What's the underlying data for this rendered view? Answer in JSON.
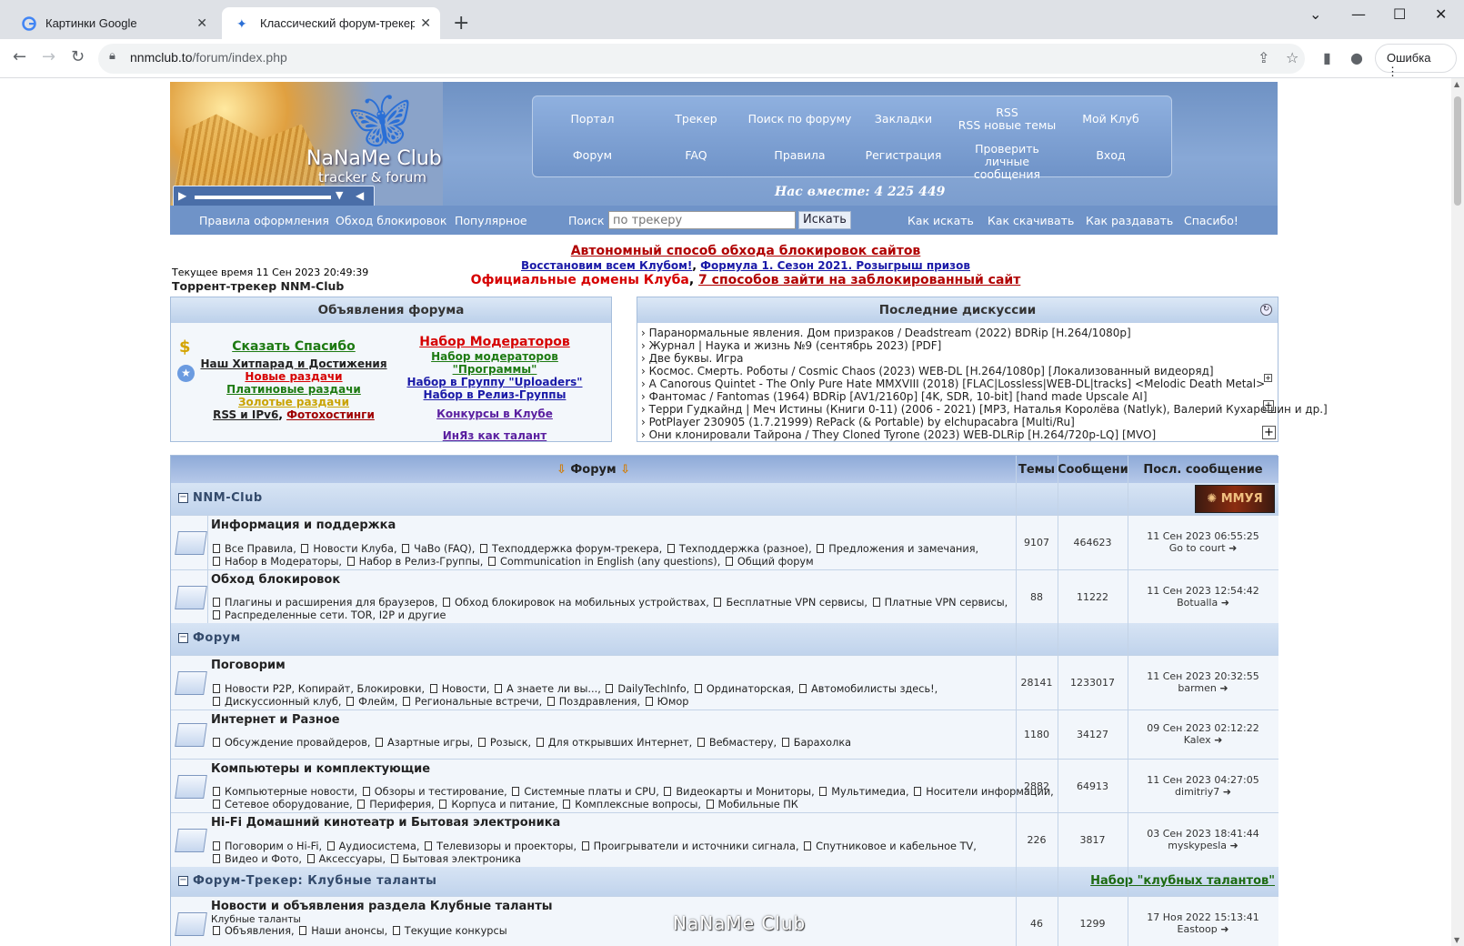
{
  "browser": {
    "tabs": [
      {
        "title": "Картинки Google",
        "close": "✕"
      },
      {
        "title": "Классический форум-трекер :: N",
        "close": "✕"
      }
    ],
    "new_tab": "+",
    "url_host": "nnmclub.to",
    "url_path": "/forum/index.php",
    "error_button": "Ошибка"
  },
  "header": {
    "logo_title": "NaNaMe Club",
    "logo_subtitle": "tracker & forum",
    "menu_top": [
      "Портал",
      "Трекер",
      "Поиск по форуму",
      "Закладки",
      "RSS\nRSS новые темы",
      "Мой Клуб"
    ],
    "menu_bottom": [
      "Форум",
      "FAQ",
      "Правила",
      "Регистрация",
      "Проверить личные сообщения",
      "Вход"
    ],
    "together": "Нас вместе: 4 225 449"
  },
  "subnav": {
    "left_links": [
      "Правила оформления",
      "Обход блокировок",
      "Популярное"
    ],
    "search_label": "Поиск :",
    "search_placeholder": "по трекеру",
    "search_button": "Искать",
    "right_links": [
      "Как искать",
      "Как скачивать",
      "Как раздавать",
      "Спасибо!"
    ]
  },
  "info": {
    "current_time": "Текущее время 11 Сен 2023 20:49:39",
    "site_name": "Торрент-трекер NNM-Club",
    "headline": "Автономный способ обхода блокировок сайтов",
    "line2_a": "Восстановим всем Клубом!",
    "line2_b": "Формула 1. Сезон 2021. Розыгрыш призов",
    "line3_a": "Официальные домены Клуба",
    "line3_b": "7 способов зайти на заблокированный сайт"
  },
  "announcements": {
    "title": "Объявления форума",
    "left": [
      "Сказать Спасибо",
      "Наш Хитпарад и Достижения",
      "Новые раздачи",
      "Платиновые раздачи",
      "Золотые раздачи",
      "RSS и IPv6",
      "Фотохостинги"
    ],
    "right": [
      "Набор Модераторов",
      "Набор модераторов \"Программы\"",
      "Набор в Группу \"Uploaders\"",
      "Набор в Релиз-Группы",
      "Конкурсы в Клубе",
      "ИнЯз как талант"
    ]
  },
  "discussions": {
    "title": "Последние дискуссии",
    "items": [
      "› Паранормальные явления. Дом призраков / Deadstream (2022) BDRip [H.264/1080p]",
      "› Журнал | Наука и жизнь №9 (сентябрь 2023) [PDF]",
      "› Две буквы. Игра",
      "› Космос. Смерть. Роботы / Cosmic Chaos (2023) WEB-DL [H.264/1080p] [Локализованный видеоряд]",
      "› A Canorous Quintet - The Only Pure Hate MMXVIII (2018) [FLAC|Lossless|WEB-DL|tracks] <Melodic Death Metal>",
      "› Фантомас / Fantomas (1964) BDRip [AV1/2160p] [4K, SDR, 10-bit] [hand made Upscale AI]",
      "› Терри Гудкайнд | Меч Истины (Книги 0-11) (2006 - 2021) [MP3, Наталья Королёва (Natlyk), Валерий Кухарешин и др.]",
      "› PotPlayer 230905 (1.7.21999) RePack (& Portable) by elchupacabra [Multi/Ru]",
      "› Они клонировали Тайрона / They Cloned Tyrone (2023) WEB-DLRip [H.264/720p-LQ] [MVO]"
    ]
  },
  "forum": {
    "head_forum": "Форум",
    "head_topics": "Темы",
    "head_posts": "Сообщений",
    "head_last": "Посл. сообщение",
    "cat_nnm": "NNM-Club",
    "cat_forum": "Форум",
    "cat_talents": "Форум-Трекер: Клубные таланты",
    "talents_link": "Набор \"клубных талантов\"",
    "rows": [
      {
        "title": "Информация и поддержка",
        "sub1": [
          "Все Правила,",
          "Новости Клуба,",
          "ЧаВо (FAQ),",
          "Техподдержка форум-трекера,",
          "Техподдержка (разное),",
          "Предложения и замечания,"
        ],
        "sub2": [
          "Набор в Модераторы,",
          "Набор в Релиз-Группы,",
          "Communication in English (any questions),",
          "Общий форум"
        ],
        "topics": "9107",
        "posts": "464623",
        "last_date": "11 Сен 2023 06:55:25",
        "last_user": "Go to court"
      },
      {
        "title": "Обход блокировок",
        "sub1": [
          "Плагины и расширения для браузеров,",
          "Обход блокировок на мобильных устройствах,",
          "Бесплатные VPN сервисы,",
          "Платные VPN сервисы,"
        ],
        "sub2": [
          "Распределенные сети. TOR, I2P и другие"
        ],
        "topics": "88",
        "posts": "11222",
        "last_date": "11 Сен 2023 12:54:42",
        "last_user": "Botualla"
      },
      {
        "title": "Поговорим",
        "sub1": [
          "Новости P2P, Копирайт, Блокировки,",
          "Новости,",
          "А знаете ли вы...,",
          "DailyTechInfo,",
          "Ординаторская,",
          "Автомобилисты здесь!,"
        ],
        "sub2": [
          "Дискуссионный клуб,",
          "Флейм,",
          "Региональные встречи,",
          "Поздравления,",
          "Юмор"
        ],
        "topics": "28141",
        "posts": "1233017",
        "last_date": "11 Сен 2023 20:32:55",
        "last_user": "barmen"
      },
      {
        "title": "Интернет и Разное",
        "sub1": [
          "Обсуждение провайдеров,",
          "Азартные игры,",
          "Розыск,",
          "Для открывших Интернет,",
          "Вебмастеру,",
          "Барахолка"
        ],
        "sub2": [],
        "topics": "1180",
        "posts": "34127",
        "last_date": "09 Сен 2023 02:12:22",
        "last_user": "Kalex"
      },
      {
        "title": "Компьютеры и комплектующие",
        "sub1": [
          "Компьютерные новости,",
          "Обзоры и тестирование,",
          "Системные платы и CPU,",
          "Видеокарты и Мониторы,",
          "Мультимедиа,",
          "Носители информации,"
        ],
        "sub2": [
          "Сетевое оборудование,",
          "Периферия,",
          "Корпуса и питание,",
          "Комплексные вопросы,",
          "Мобильные ПК"
        ],
        "topics": "2882",
        "posts": "64913",
        "last_date": "11 Сен 2023 04:27:05",
        "last_user": "dimitriy7"
      },
      {
        "title": "Hi-Fi Домашний кинотеатр и Бытовая электроника",
        "sub1": [
          "Поговорим о Hi-Fi,",
          "Аудиосистема,",
          "Телевизоры и проекторы,",
          "Проигрыватели и источники сигнала,",
          "Спутниковое и кабельное TV,"
        ],
        "sub2": [
          "Видео и Фото,",
          "Аксессуары,",
          "Бытовая электроника"
        ],
        "topics": "226",
        "posts": "3817",
        "last_date": "03 Сен 2023 18:41:44",
        "last_user": "myskypesla"
      },
      {
        "title": "Новости и объявления раздела Клубные таланты",
        "desc": "Клубные таланты",
        "sub1": [
          "Объявления,",
          "Наши анонсы,",
          "Текущие конкурсы"
        ],
        "sub2": [],
        "topics": "46",
        "posts": "1299",
        "last_date": "17 Ноя 2022 15:13:41",
        "last_user": "Eastoop"
      }
    ]
  },
  "watermark": "NaNaMe Club"
}
